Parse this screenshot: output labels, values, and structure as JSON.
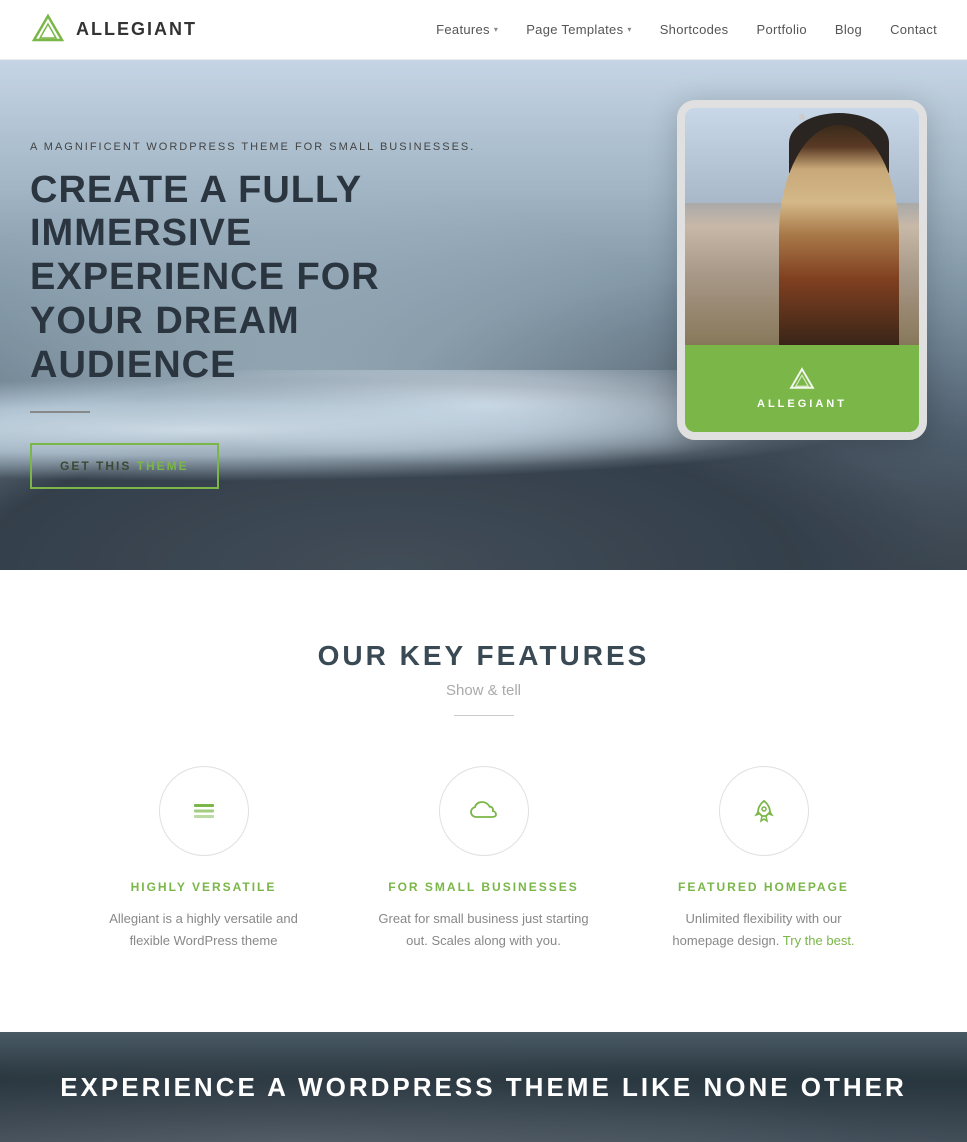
{
  "brand": {
    "name": "ALLEGIANT",
    "logo_alt": "Allegiant logo"
  },
  "nav": {
    "items": [
      {
        "label": "Features",
        "has_dropdown": true
      },
      {
        "label": "Page Templates",
        "has_dropdown": true
      },
      {
        "label": "Shortcodes",
        "has_dropdown": false
      },
      {
        "label": "Portfolio",
        "has_dropdown": false
      },
      {
        "label": "Blog",
        "has_dropdown": false
      },
      {
        "label": "Contact",
        "has_dropdown": false
      }
    ]
  },
  "hero": {
    "tagline": "A MAGNIFICENT WORDPRESS THEME FOR SMALL BUSINESSES.",
    "title": "CREATE A FULLY IMMERSIVE EXPERIENCE FOR YOUR DREAM AUDIENCE",
    "cta_label": "GET THIS THEME",
    "tablet_brand": "ALLEGIANT"
  },
  "features": {
    "title": "OUR KEY FEATURES",
    "subtitle": "Show & tell",
    "items": [
      {
        "icon": "layers",
        "title": "HIGHLY VERSATILE",
        "description": "Allegiant is a highly versatile and flexible WordPress theme"
      },
      {
        "icon": "cloud",
        "title": "FOR SMALL BUSINESSES",
        "description": "Great for small business just starting out. Scales along with you."
      },
      {
        "icon": "rocket",
        "title": "FEATURED HOMEPAGE",
        "description": "Unlimited flexibility with our homepage design. Try the best."
      }
    ]
  },
  "bottom": {
    "title": "EXPERIENCE A WORDPRESS THEME LIKE NONE OTHER"
  }
}
